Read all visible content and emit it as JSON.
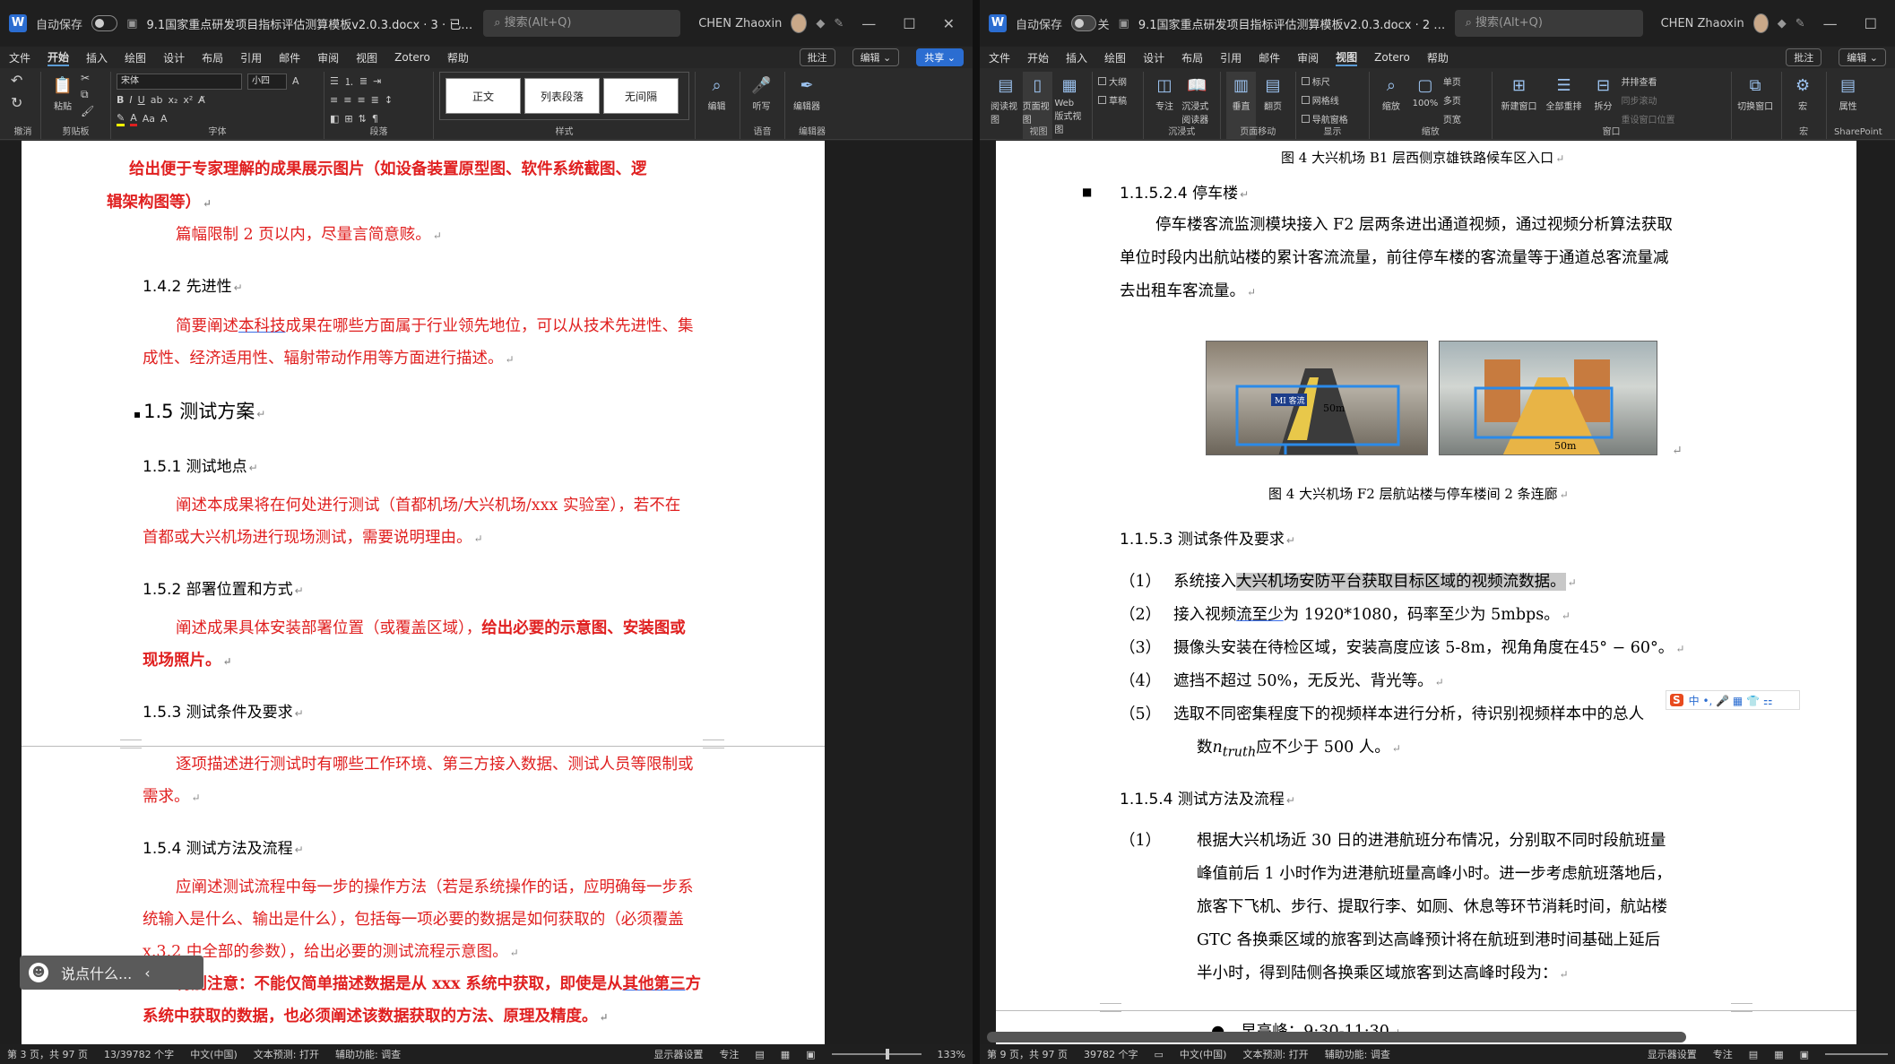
{
  "left": {
    "autosave_label": "自动保存",
    "doc_title": "9.1国家重点研发项目指标评估测算模板v2.0.3.docx · 3 · 已保存到这台电脑 ⌄",
    "search_placeholder": "搜索(Alt+Q)",
    "user_name": "CHEN Zhaoxin",
    "menu": [
      "文件",
      "开始",
      "插入",
      "绘图",
      "设计",
      "布局",
      "引用",
      "邮件",
      "审阅",
      "视图",
      "Zotero",
      "帮助"
    ],
    "menu_active": "开始",
    "comment_btn": "批注",
    "edit_btn": "编辑 ⌄",
    "share_btn": "共享 ⌄",
    "font_name": "宋体",
    "font_size": "小四",
    "styles": [
      "正文",
      "列表段落",
      "无间隔"
    ],
    "group_labels": [
      "撤消",
      "剪贴板",
      "字体",
      "段落",
      "样式",
      "语音",
      "编辑器"
    ],
    "big_buttons": {
      "paste": "粘贴",
      "find": "编辑",
      "dictate": "听写",
      "editor": "编辑器"
    },
    "lines": [
      "给出便于专家理解的成果展示图片（如设备装置原型图、软件系统截图、逻",
      "辑架构图等）",
      "篇幅限制 2 页以内，尽量言简意赅。",
      "1.4.2 先进性",
      "简要阐述",
      "本科技",
      "成果在哪些方面属于行业领先地位，可以从技术先进性、集",
      "成性、经济适用性、辐射带动作用等方面进行描述。",
      "1.5 测试方案",
      "1.5.1 测试地点",
      "阐述本成果将在何处进行测试（首都机场/大兴机场/xxx 实验室），若不在",
      "首都或大兴机场进行现场测试，需要说明理由。",
      "1.5.2 部署位置和方式",
      "阐述成果具体安装部署位置（或覆盖区域），",
      "给出必要的示意图、安装图或",
      "现场照片。",
      "1.5.3 测试条件及要求",
      "逐项描述进行测试时有哪些工作环境、第三方接入数据、测试人员等限制或",
      "需求。",
      "1.5.4 测试方法及流程",
      "应阐述测试流程中每一步的操作方法（若是系统操作的话，应明确每一步系",
      "统输入是什么、输出是什么），包括每一项必要的数据是如何获取的（必须覆盖",
      "x.3.2 中全部的参数），给出必要的测试流程示意图。",
      "特别注意：不能仅简单描述数据是从 xxx 系统中获取，即使是从",
      "其他第三",
      "方",
      "系统中获取的数据，也必须阐述该数据获取的方法、原理及精度。"
    ],
    "chat_placeholder": "说点什么...",
    "status": [
      "第 3 页，共 97 页",
      "13/39782 个字",
      "中文(中国)",
      "文本预测: 打开",
      "辅助功能: 调查",
      "显示器设置",
      "专注",
      "133%"
    ]
  },
  "right": {
    "autosave_label": "自动保存",
    "toggle_label": "关",
    "doc_title": "9.1国家重点研发项目指标评估测算模板v2.0.3.docx · 2 · 已保存到这台电脑 ⌄",
    "search_placeholder": "搜索(Alt+Q)",
    "user_name": "CHEN Zhaoxin",
    "menu": [
      "文件",
      "开始",
      "插入",
      "绘图",
      "设计",
      "布局",
      "引用",
      "邮件",
      "审阅",
      "视图",
      "Zotero",
      "帮助"
    ],
    "menu_active": "视图",
    "comment_btn": "批注",
    "edit_btn": "编辑 ⌄",
    "view_buttons": [
      "阅读视图",
      "页面视图",
      "Web 版式视图",
      "专注",
      "沉浸式阅读器",
      "垂直",
      "翻页",
      "缩放",
      "100%",
      "新建窗口",
      "全部重排",
      "拆分",
      "切换窗口",
      "宏",
      "属性"
    ],
    "checks": [
      "大纲",
      "草稿",
      "标尺",
      "网格线",
      "导航窗格",
      "单页",
      "多页",
      "页宽",
      "并排查看",
      "同步滚动",
      "重设窗口位置"
    ],
    "group_labels": [
      "视图",
      "沉浸式",
      "页面移动",
      "显示",
      "缩放",
      "窗口",
      "宏",
      "SharePoint"
    ],
    "fig_top_caption": "图 4 大兴机场 B1 层西侧京雄铁路候车区入口",
    "heading_park": "1.1.5.2.4 停车楼",
    "park_lines": [
      "停车楼客流监测模块接入 F2 层两条进出通道视频，通过视频分析算法获取",
      "单位时段内出航站楼的累计客流流量，前往停车楼的客流量等于通道总客流量减",
      "去出租车客流量。"
    ],
    "img_labels": [
      "MI 客流",
      "50m"
    ],
    "fig_caption": "图 4 大兴机场 F2 层航站楼与停车楼间 2 条连廊",
    "heading_cond": "1.1.5.3 测试条件及要求",
    "cond_items": [
      {
        "num": "（1）",
        "pre": "系统接入",
        "hl": "大兴机场安防平台获取目标区域的视频流数据。"
      },
      {
        "num": "（2）",
        "pre": "接入视频",
        "ul": "流至少",
        "post": "为 1920*1080，码率至少为 5mbps。"
      },
      {
        "num": "（3）",
        "pre": "摄像头安装在待检区域，安装高度应该 5-8m，视角角度在45° − 60°。"
      },
      {
        "num": "（4）",
        "pre": "遮挡不超过 50%，无反光、背光等。"
      },
      {
        "num": "（5）",
        "pre": "选取不同密集程度下的视频样本进行分析，待识别视频样本中的总人"
      }
    ],
    "cond5_line2_pre": "数",
    "cond5_var": "n",
    "cond5_sub": "truth",
    "cond5_line2_post": "应不少于 500 人。",
    "heading_method": "1.1.5.4 测试方法及流程",
    "method_lines": [
      "根据大兴机场近 30 日的进港航班分布情况，分别取不同时段航班量",
      "峰值前后 1 小时作为进港航班量高峰小时。进一步考虑航班落地后，",
      "旅客下飞机、步行、提取行李、如厕、休息等环节消耗时间，航站楼",
      "GTC 各换乘区域的旅客到达高峰预计将在航班到港时间基础上延后",
      "半小时，得到陆侧各换乘区域旅客到达高峰时段为："
    ],
    "method_num": "（1）",
    "bullet_line": "早高峰：9:30-11:30",
    "ime_text": "中 •, 🎤 ▦ 👕 ⚏",
    "status": [
      "第 9 页，共 97 页",
      "39782 个字",
      "中文(中国)",
      "文本预测: 打开",
      "辅助功能: 调查",
      "显示器设置",
      "专注"
    ]
  }
}
